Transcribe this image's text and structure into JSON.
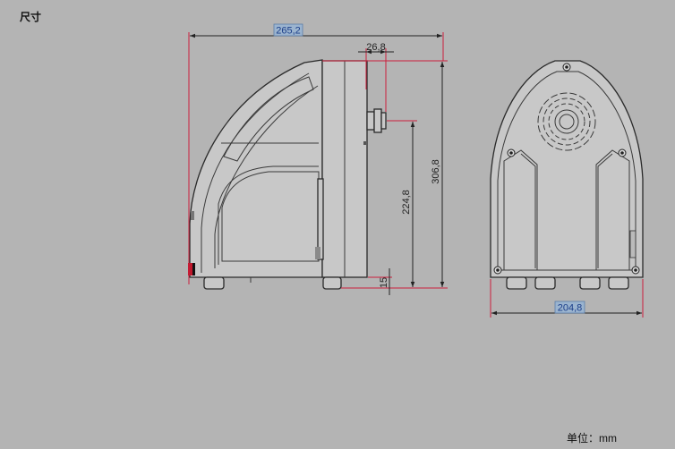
{
  "header": {
    "title": "尺寸"
  },
  "footer": {
    "unit": "单位：mm"
  },
  "dimensions": {
    "overall_width_side": "265,2",
    "flange_depth": "26,8",
    "overall_height": "306,8",
    "outlet_height": "224,8",
    "foot_height": "15",
    "front_width": "204,8"
  },
  "colors": {
    "background": "#b4b4b4",
    "extension_line": "#cc1e3c",
    "dimension_box": "#9bb4cf",
    "dimension_text": "#1c3f8a"
  }
}
